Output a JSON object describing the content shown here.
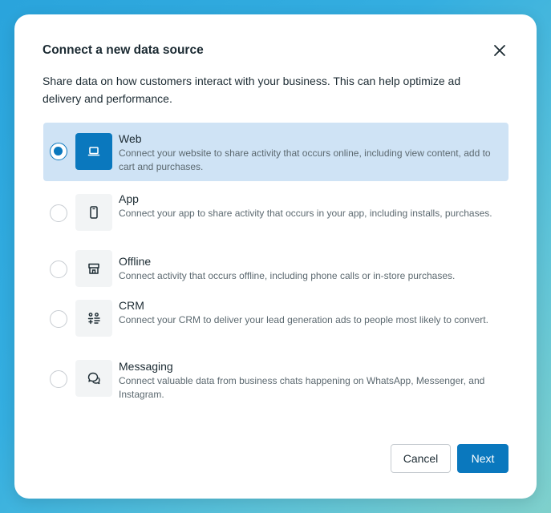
{
  "dialog": {
    "title": "Connect a new data source",
    "description": "Share data on how customers interact with your business. This can help optimize ad delivery and performance."
  },
  "options": [
    {
      "title": "Web",
      "description": "Connect your website to share activity that occurs online, including view content, add to cart and purchases.",
      "icon": "laptop-icon",
      "selected": true
    },
    {
      "title": "App",
      "description": "Connect your app to share activity that occurs in your app, including installs, purchases.",
      "icon": "mobile-phone-icon",
      "selected": false
    },
    {
      "title": "Offline",
      "description": "Connect activity that occurs offline, including phone calls or in-store purchases.",
      "icon": "storefront-icon",
      "selected": false
    },
    {
      "title": "CRM",
      "description": "Connect your CRM to deliver your lead generation ads to people most likely to convert.",
      "icon": "crm-sliders-icon",
      "selected": false
    },
    {
      "title": "Messaging",
      "description": "Connect valuable data from business chats happening on WhatsApp, Messenger, and Instagram.",
      "icon": "chat-bubbles-icon",
      "selected": false
    }
  ],
  "footer": {
    "cancel_label": "Cancel",
    "next_label": "Next"
  },
  "colors": {
    "accent": "#0a78be",
    "selected_row": "#cfe3f5",
    "text_primary": "#1c2b33",
    "text_secondary": "#5c6970"
  }
}
